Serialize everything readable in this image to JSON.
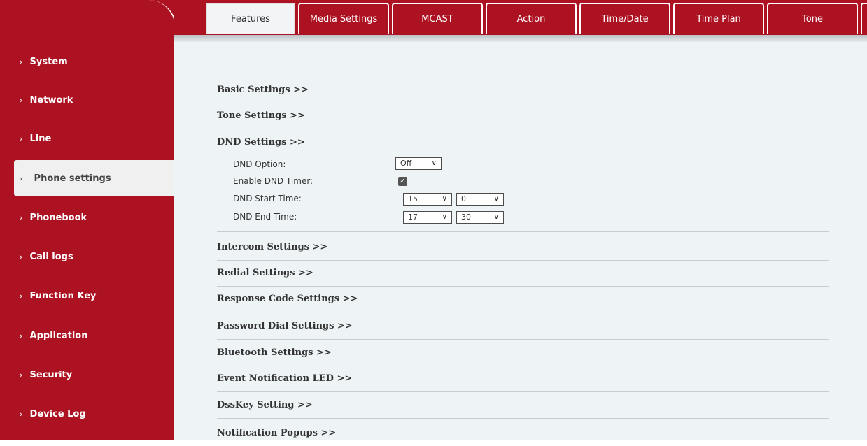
{
  "sidebar": {
    "items": [
      {
        "label": "System",
        "active": false
      },
      {
        "label": "Network",
        "active": false
      },
      {
        "label": "Line",
        "active": false
      },
      {
        "label": "Phone settings",
        "active": true
      },
      {
        "label": "Phonebook",
        "active": false
      },
      {
        "label": "Call logs",
        "active": false
      },
      {
        "label": "Function Key",
        "active": false
      },
      {
        "label": "Application",
        "active": false
      },
      {
        "label": "Security",
        "active": false
      },
      {
        "label": "Device Log",
        "active": false
      }
    ]
  },
  "tabs": [
    {
      "label": "Features",
      "active": true
    },
    {
      "label": "Media Settings",
      "active": false
    },
    {
      "label": "MCAST",
      "active": false
    },
    {
      "label": "Action",
      "active": false
    },
    {
      "label": "Time/Date",
      "active": false
    },
    {
      "label": "Time Plan",
      "active": false
    },
    {
      "label": "Tone",
      "active": false
    }
  ],
  "sections": {
    "basic": "Basic Settings >>",
    "tone": "Tone Settings >>",
    "dnd": "DND Settings >>",
    "intercom": "Intercom Settings >>",
    "redial": "Redial Settings >>",
    "response_code": "Response Code Settings >>",
    "password_dial": "Password Dial Settings >>",
    "bluetooth": "Bluetooth Settings >>",
    "event_led": "Event Notification LED >>",
    "dsskey": "DssKey Setting >>",
    "notification": "Notification Popups >>"
  },
  "dnd": {
    "option_label": "DND Option:",
    "option_value": "Off",
    "timer_label": "Enable DND Timer:",
    "timer_checked": true,
    "start_label": "DND Start Time:",
    "start_hour": "15",
    "start_minute": "0",
    "end_label": "DND End Time:",
    "end_hour": "17",
    "end_minute": "30"
  },
  "colors": {
    "brand": "#ad1222",
    "content_bg": "#eef4f6"
  },
  "icons": {
    "nav_chevron": "chevron-right-icon",
    "select_caret": "chevron-down-icon",
    "checkbox": "checkmark-icon"
  }
}
